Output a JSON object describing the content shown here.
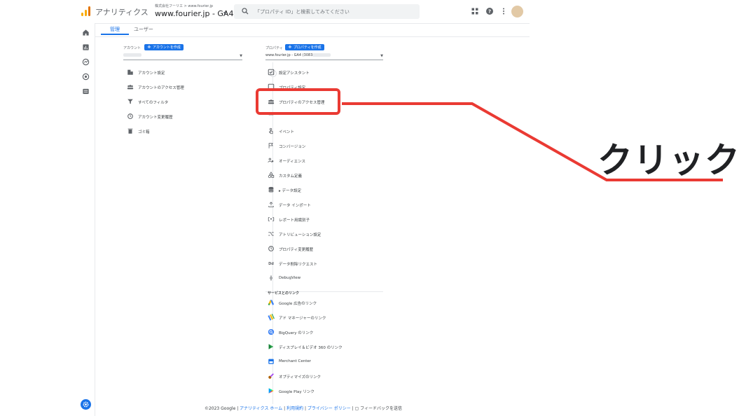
{
  "app": {
    "name": "アナリティクス",
    "account_crumb": "株式会社フーリエ > www.fourier.jp",
    "property_name": "www.fourier.jp - GA4",
    "search_placeholder": "「プロパティ ID」と検索してみてください"
  },
  "tabs": [
    "管理",
    "ユーザー"
  ],
  "account_column": {
    "label": "アカウント",
    "create_button": "アカウントを作成",
    "items": [
      {
        "icon": "building-icon",
        "label": "アカウント設定"
      },
      {
        "icon": "people-icon",
        "label": "アカウントのアクセス管理"
      },
      {
        "icon": "filter-icon",
        "label": "すべてのフィルタ"
      },
      {
        "icon": "history-icon",
        "label": "アカウント変更履歴"
      },
      {
        "icon": "trash-icon",
        "label": "ゴミ箱"
      }
    ]
  },
  "property_column": {
    "label": "プロパティ",
    "create_button": "プロパティを作成",
    "selected": "www.fourier.jp - GA4 (3083",
    "items": [
      {
        "icon": "checklist-icon",
        "label": "設定アシスタント"
      },
      {
        "icon": "settings-icon",
        "label": "プロパティ設定"
      },
      {
        "icon": "people-icon",
        "label": "プロパティのアクセス管理"
      },
      {
        "icon": "stream-icon",
        "label": ""
      },
      {
        "icon": "touch-icon",
        "label": "イベント"
      },
      {
        "icon": "flag-icon",
        "label": "コンバージョン"
      },
      {
        "icon": "audience-icon",
        "label": "オーディエンス"
      },
      {
        "icon": "shapes-icon",
        "label": "カスタム定義"
      },
      {
        "icon": "database-icon",
        "label": "▸ データ設定"
      },
      {
        "icon": "upload-icon",
        "label": "データ インポート"
      },
      {
        "icon": "identity-icon",
        "label": "レポート用識別子"
      },
      {
        "icon": "attribution-icon",
        "label": "アトリビューション設定"
      },
      {
        "icon": "history-icon",
        "label": "プロパティ変更履歴"
      },
      {
        "icon": "dd-icon",
        "label": "データ削除リクエスト"
      },
      {
        "icon": "debug-icon",
        "label": "DebugView"
      }
    ],
    "links_header": "サービスとのリンク",
    "links": [
      {
        "icon": "google-ads-icon",
        "label": "Google 広告のリンク"
      },
      {
        "icon": "ad-manager-icon",
        "label": "アド マネージャーのリンク"
      },
      {
        "icon": "bigquery-icon",
        "label": "BigQuery のリンク"
      },
      {
        "icon": "dv360-icon",
        "label": "ディスプレイ＆ビデオ 360 のリンク"
      },
      {
        "icon": "merchant-center-icon",
        "label": "Merchant Center"
      },
      {
        "icon": "optimize-icon",
        "label": "オプティマイズのリンク"
      },
      {
        "icon": "google-play-icon",
        "label": "Google Play リンク"
      }
    ]
  },
  "footer": {
    "copyright": "©2023 Google |",
    "home_link": "アナリティクス ホーム",
    "terms_link": "利用規約",
    "privacy_link": "プライバシー ポリシー",
    "feedback": "フィードバックを送信"
  },
  "annotation": {
    "text": "クリック",
    "color": "#ea3a33"
  },
  "colors": {
    "accent": "#1a73e8",
    "highlight": "#ea3a33"
  }
}
